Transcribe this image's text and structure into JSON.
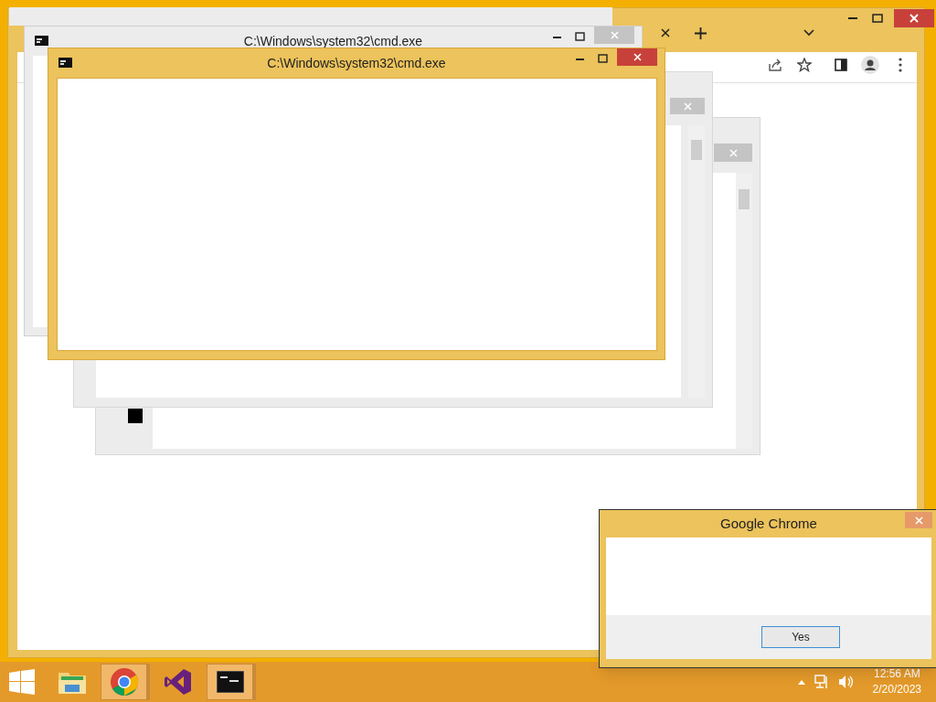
{
  "cmd_windows": [
    {
      "title": "C:\\Windows\\system32\\cmd.exe",
      "active": false
    },
    {
      "title": "C:\\Windows\\system32\\cmd.exe",
      "active": true
    }
  ],
  "dialog": {
    "title": "Google Chrome",
    "button": "Yes"
  },
  "taskbar": {
    "items": [
      {
        "kind": "explorer",
        "running": false
      },
      {
        "kind": "chrome",
        "running": true
      },
      {
        "kind": "vs",
        "running": false
      },
      {
        "kind": "cmd",
        "running": true
      }
    ],
    "time": "12:56 AM",
    "date": "2/20/2023"
  }
}
